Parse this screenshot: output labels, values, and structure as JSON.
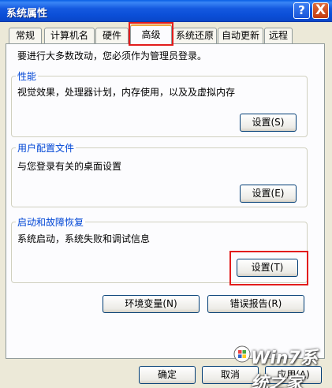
{
  "window": {
    "title": "系统属性",
    "help_symbol": "?",
    "close_symbol": "X"
  },
  "tabs": [
    {
      "label": "常规",
      "active": false
    },
    {
      "label": "计算机名",
      "active": false
    },
    {
      "label": "硬件",
      "active": false
    },
    {
      "label": "高级",
      "active": true
    },
    {
      "label": "系统还原",
      "active": false
    },
    {
      "label": "自动更新",
      "active": false
    },
    {
      "label": "远程",
      "active": false
    }
  ],
  "intro_text": "要进行大多数改动，您必须作为管理员登录。",
  "groups": {
    "performance": {
      "title": "性能",
      "description": "视觉效果，处理器计划，内存使用，以及及虚拟内存",
      "button": "设置(S)"
    },
    "user_profiles": {
      "title": "用户配置文件",
      "description": "与您登录有关的桌面设置",
      "button": "设置(E)"
    },
    "startup_recovery": {
      "title": "启动和故障恢复",
      "description": "系统启动，系统失败和调试信息",
      "button": "设置(T)"
    }
  },
  "buttons": {
    "env_vars": "环境变量(N)",
    "error_report": "错误报告(R)",
    "ok": "确定",
    "cancel": "取消",
    "apply": "应用(A)"
  },
  "watermark": "Win7系统之家",
  "colors": {
    "titlebar": "#0b4fd8",
    "group_title": "#0046d5",
    "highlight": "#e21c1c",
    "active_tab_accent": "#f0a33a"
  }
}
